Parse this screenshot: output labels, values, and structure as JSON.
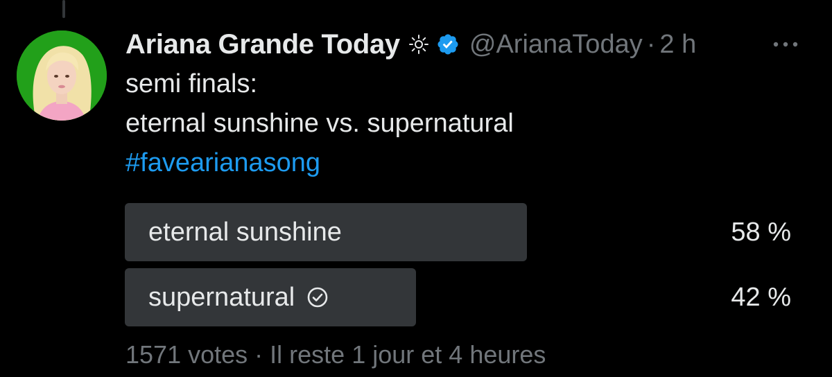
{
  "tweet": {
    "author_name": "Ariana Grande Today",
    "handle": "@ArianaToday",
    "separator": "·",
    "time": "2 h",
    "text_lines": [
      "semi finals:",
      "eternal sunshine vs. supernatural"
    ],
    "hashtag": "#favearianasong"
  },
  "poll": {
    "options": [
      {
        "label": "eternal sunshine",
        "percent_label": "58 %",
        "percent": 58,
        "selected": false
      },
      {
        "label": "supernatural",
        "percent_label": "42 %",
        "percent": 42,
        "selected": true
      }
    ],
    "votes": "1571 votes",
    "separator": "·",
    "time_left": "Il reste 1 jour et 4 heures"
  },
  "icons": {
    "sun": "sun-icon",
    "verified": "verified-badge-icon",
    "more": "more-horizontal-icon",
    "check": "check-circle-icon"
  },
  "colors": {
    "background": "#000000",
    "text": "#e7e9ea",
    "muted": "#71767b",
    "accent": "#1d9bf0",
    "poll_bar": "#333639",
    "avatar_bg": "#22a01a"
  }
}
